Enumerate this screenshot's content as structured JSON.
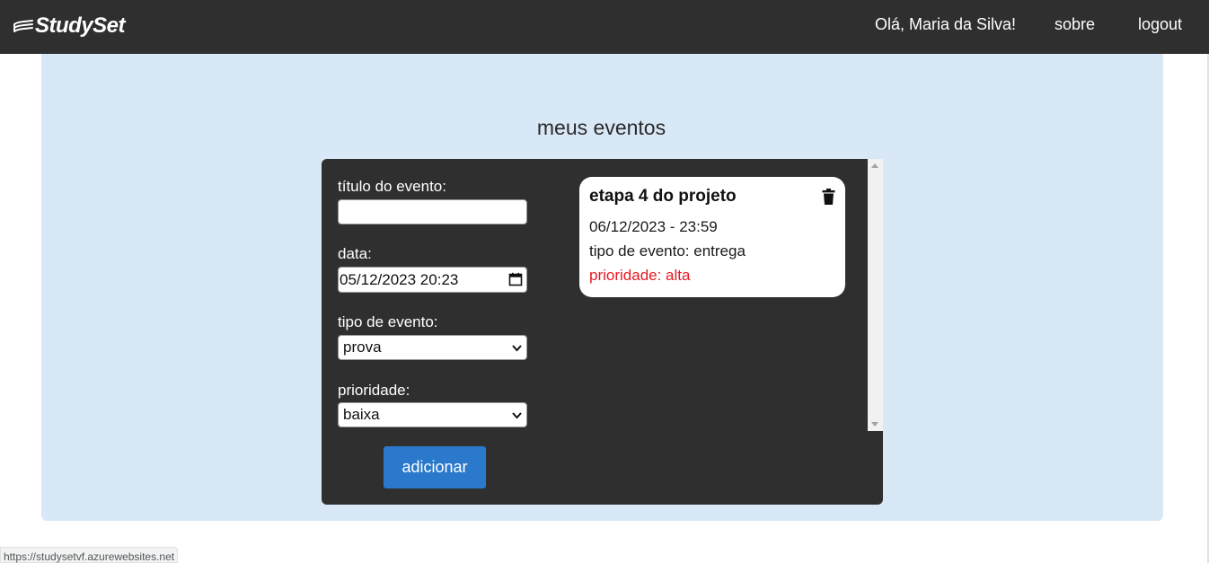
{
  "navbar": {
    "logo_text": "StudySet",
    "greeting": "Olá, Maria da Silva!",
    "links": [
      "sobre",
      "logout"
    ]
  },
  "main": {
    "heading": "meus eventos",
    "form": {
      "title_label": "título do evento:",
      "title_value": "",
      "date_label": "data:",
      "date_value": "05/12/2023 20:23",
      "type_label": "tipo de evento:",
      "type_selected": "prova",
      "priority_label": "prioridade:",
      "priority_selected": "baixa",
      "add_button": "adicionar"
    },
    "events": [
      {
        "title": "etapa 4 do projeto",
        "date": "06/12/2023 - 23:59",
        "type": "tipo de evento: entrega",
        "priority": "prioridade: alta"
      }
    ]
  },
  "status_bar": {
    "url": "https://studysetvf.azurewebsites.net"
  },
  "colors": {
    "navbar_bg": "#2f2f2f",
    "content_bg": "#d9e8f7",
    "panel_bg": "#2f2f2f",
    "button_blue": "#2a79cc",
    "priority_red": "#e51b23"
  },
  "icons": [
    "books-logo-icon",
    "calendar-icon",
    "chevron-down-icon",
    "trash-icon"
  ]
}
